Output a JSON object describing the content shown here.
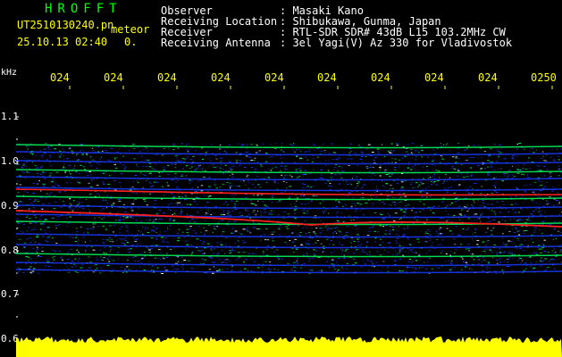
{
  "header": {
    "app_title": "HROFFT",
    "file_name": "UT2510130240.pn",
    "mode_label": "meteor",
    "date_time": "25.10.13 02:40",
    "zoom_value": "0.",
    "info": [
      {
        "label": "Observer",
        "value": ": Masaki Kano"
      },
      {
        "label": "Receiving Location",
        "value": ": Shibukawa, Gunma, Japan"
      },
      {
        "label": "Receiver",
        "value": ": RTL-SDR SDR# 43dB L15 103.2MHz CW"
      },
      {
        "label": "Receiving Antenna",
        "value": ": 3el Yagi(V) Az 330 for Vladivostok"
      }
    ]
  },
  "axes": {
    "unit_label": "kHz",
    "y_ticks": [
      "1.1",
      "1.0",
      "0.9",
      "0.8",
      "0.7",
      "0.6"
    ],
    "x_ticks": [
      "024",
      "024",
      "024",
      "024",
      "024",
      "024",
      "024",
      "024",
      "024",
      "0250"
    ]
  },
  "colors": {
    "background": "#000000",
    "title": "#00ff00",
    "text": "#ffffff",
    "accent": "#ffff00",
    "noise_floor": "#ffff00",
    "signal_low": "#1a3cff",
    "signal_mid": "#00ff60",
    "signal_high": "#ff2020"
  }
}
